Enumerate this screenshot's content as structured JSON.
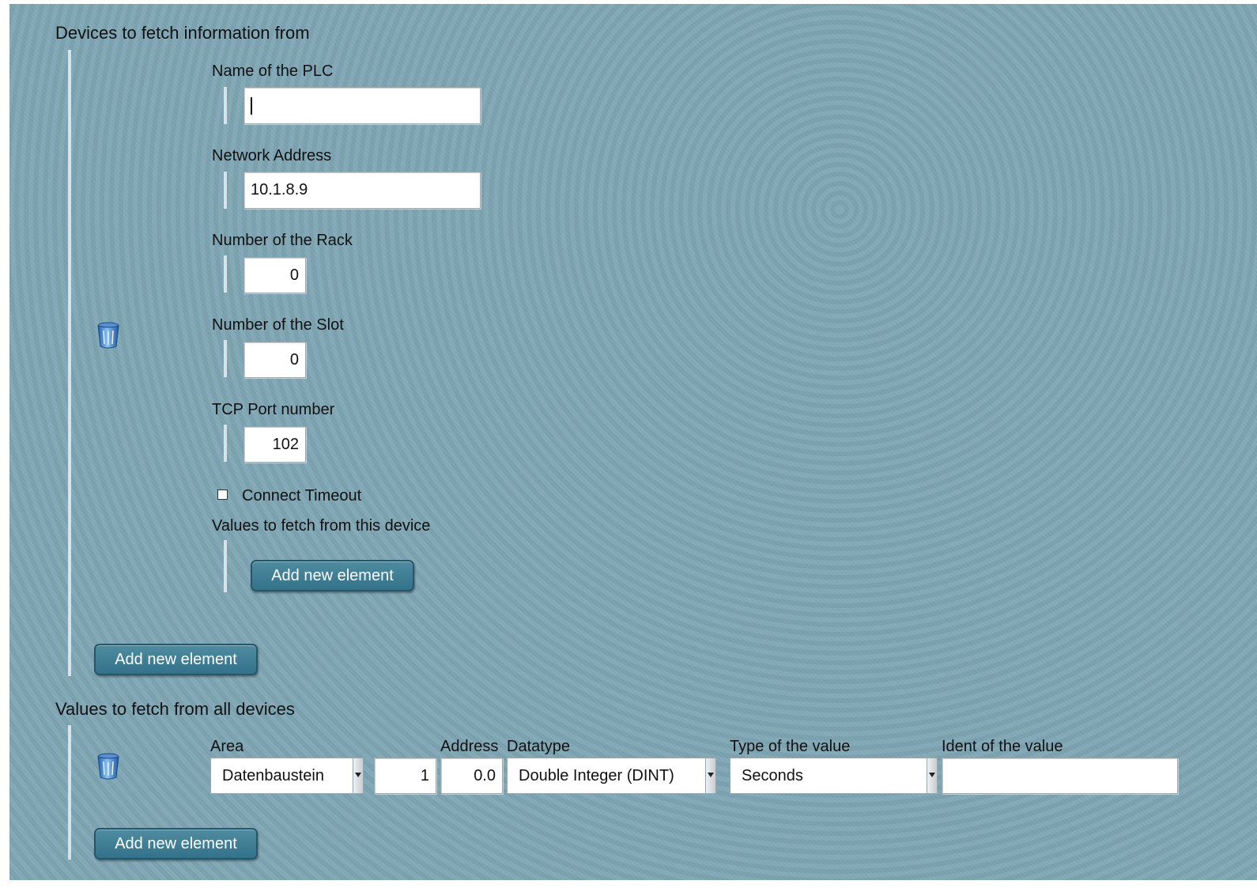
{
  "devices_section": {
    "heading": "Devices to fetch information from",
    "fields": {
      "plc_name": {
        "label": "Name of the PLC",
        "value": ""
      },
      "network_address": {
        "label": "Network Address",
        "value": "10.1.8.9"
      },
      "rack": {
        "label": "Number of the Rack",
        "value": "0"
      },
      "slot": {
        "label": "Number of the Slot",
        "value": "0"
      },
      "tcp_port": {
        "label": "TCP Port number",
        "value": "102"
      }
    },
    "connect_timeout": {
      "label": "Connect Timeout",
      "checked": false
    },
    "values_subsection": {
      "label": "Values to fetch from this device",
      "add_button": "Add new element"
    },
    "add_button": "Add new element",
    "delete_icon": "trash-icon"
  },
  "values_section": {
    "heading": "Values to fetch from all devices",
    "columns": {
      "area": "Area",
      "address": "Address",
      "datatype": "Datatype",
      "type_of_value": "Type of the value",
      "ident": "Ident of the value"
    },
    "row": {
      "area": "Datenbaustein",
      "db_number": "1",
      "address": "0.0",
      "datatype": "Double Integer (DINT)",
      "type_of_value": "Seconds",
      "ident": ""
    },
    "add_button": "Add new element",
    "delete_icon": "trash-icon"
  },
  "colors": {
    "background": "#7fa6b5",
    "button": "#3f7f95"
  }
}
